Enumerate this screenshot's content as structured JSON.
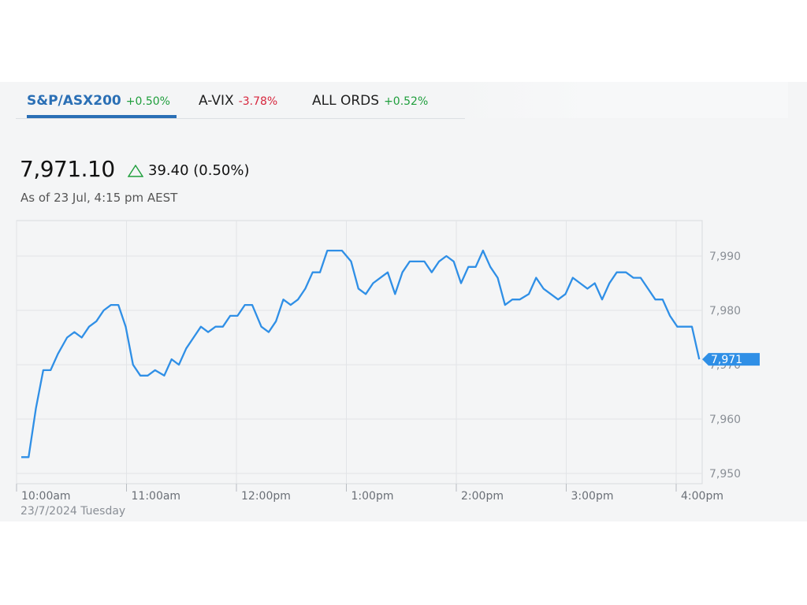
{
  "tabs": [
    {
      "name": "S&P/ASX200",
      "change": "+0.50%",
      "direction": "up",
      "active": true
    },
    {
      "name": "A-VIX",
      "change": "-3.78%",
      "direction": "down",
      "active": false
    },
    {
      "name": "ALL ORDS",
      "change": "+0.52%",
      "direction": "up",
      "active": false
    }
  ],
  "quote": {
    "price": "7,971.10",
    "change": "39.40 (0.50%)",
    "as_of": "As of 23 Jul, 4:15 pm AEST"
  },
  "colors": {
    "accent": "#2a6fb5",
    "line": "#2f8fe6",
    "up": "#1f9e3c",
    "down": "#d7263d"
  },
  "chart_data": {
    "type": "line",
    "title": "",
    "xlabel": "",
    "ylabel": "",
    "date_label": "23/7/2024 Tuesday",
    "x_ticks": [
      "10:00am",
      "11:00am",
      "12:00pm",
      "1:00pm",
      "2:00pm",
      "3:00pm",
      "4:00pm"
    ],
    "y_ticks": [
      7950,
      7960,
      7970,
      7980,
      7990
    ],
    "y_tick_labels": [
      "7,950",
      "7,960",
      "7,970",
      "7,980",
      "7,990"
    ],
    "ylim": [
      7948.5,
      7996.5
    ],
    "x_unit": "minutes after 10:00am",
    "xlim": [
      0,
      372
    ],
    "last_value_label": "7,971",
    "series": [
      {
        "x": [
          0,
          4,
          8,
          12,
          16,
          20,
          25,
          29,
          33,
          37,
          41,
          45,
          49,
          53,
          57,
          61,
          65,
          69,
          73,
          78,
          82,
          86,
          90,
          94,
          98,
          102,
          106,
          110,
          114,
          118,
          122,
          126,
          131,
          135,
          139,
          143,
          147,
          151,
          155,
          159,
          163,
          167,
          171,
          175,
          180,
          184,
          188,
          192,
          196,
          200,
          204,
          208,
          212,
          216,
          220,
          224,
          228,
          232,
          236,
          240,
          244,
          248,
          252,
          256,
          260,
          264,
          268,
          272,
          277,
          281,
          285,
          289,
          293,
          297,
          301,
          305,
          309,
          313,
          317,
          321,
          325,
          330,
          334,
          338,
          342,
          346,
          350,
          354,
          358,
          362,
          366,
          370
        ],
        "values": [
          7953,
          7953,
          7962,
          7969,
          7969,
          7972,
          7975,
          7976,
          7975,
          7977,
          7978,
          7980,
          7981,
          7981,
          7977,
          7970,
          7968,
          7968,
          7969,
          7968,
          7971,
          7970,
          7973,
          7975,
          7977,
          7976,
          7977,
          7977,
          7979,
          7979,
          7981,
          7981,
          7977,
          7976,
          7978,
          7982,
          7981,
          7982,
          7984,
          7987,
          7987,
          7991,
          7991,
          7991,
          7989,
          7984,
          7983,
          7985,
          7986,
          7987,
          7983,
          7987,
          7989,
          7989,
          7989,
          7987,
          7989,
          7990,
          7989,
          7985,
          7988,
          7988,
          7991,
          7988,
          7986,
          7981,
          7982,
          7982,
          7983,
          7986,
          7984,
          7983,
          7982,
          7983,
          7986,
          7985,
          7984,
          7985,
          7982,
          7985,
          7987,
          7987,
          7986,
          7986,
          7984,
          7982,
          7982,
          7979,
          7977,
          7977,
          7977,
          7971
        ]
      }
    ]
  }
}
